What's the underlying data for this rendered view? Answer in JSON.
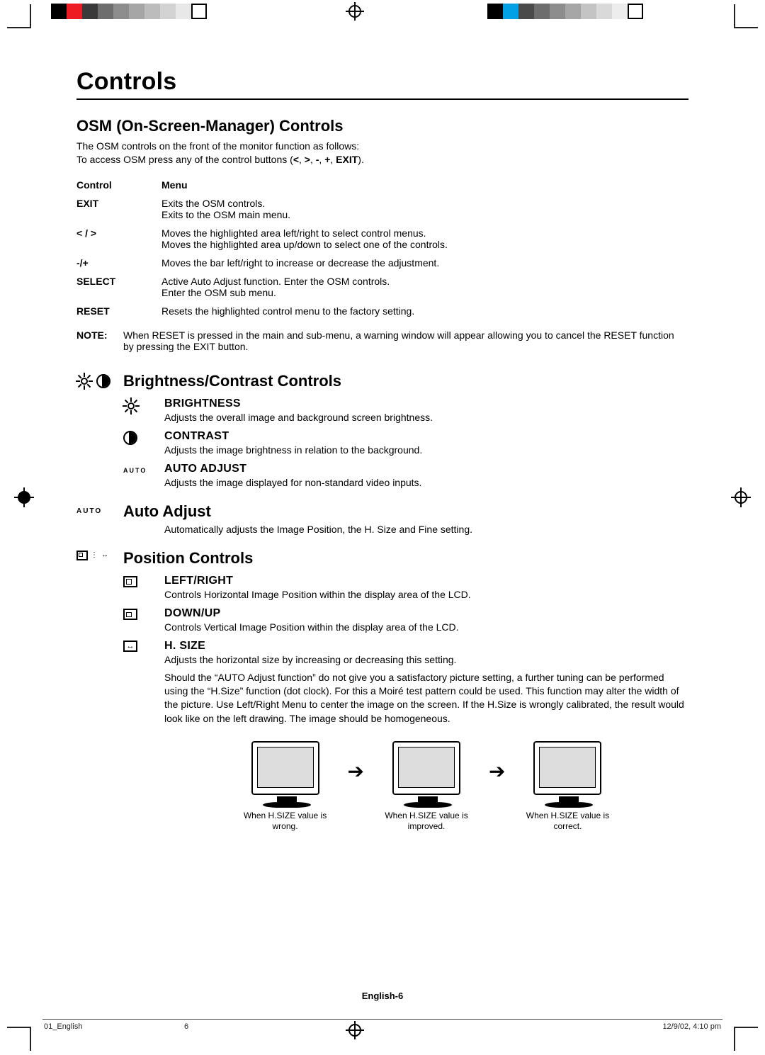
{
  "heading": "Controls",
  "osm": {
    "title": "OSM (On-Screen-Manager) Controls",
    "intro_line1": "The OSM controls on the front of the monitor function as follows:",
    "intro_line2_prefix": "To access OSM press any of the control buttons (",
    "intro_buttons": [
      "<",
      ">",
      "-",
      "+",
      "EXIT"
    ],
    "intro_line2_suffix": ").",
    "col_control": "Control",
    "col_menu": "Menu",
    "rows": [
      {
        "control": "EXIT",
        "menu": [
          "Exits the OSM controls.",
          "Exits to the OSM main menu."
        ]
      },
      {
        "control": "< / >",
        "menu": [
          "Moves the highlighted area left/right to select control menus.",
          "Moves the highlighted area up/down to select one of the controls."
        ]
      },
      {
        "control": "-/+",
        "menu": [
          "Moves the bar left/right to increase or decrease the adjustment."
        ]
      },
      {
        "control": "SELECT",
        "menu": [
          "Active Auto Adjust function. Enter the OSM controls.",
          "Enter the OSM sub menu."
        ]
      },
      {
        "control": "RESET",
        "menu": [
          "Resets the highlighted control menu to the factory setting."
        ]
      }
    ],
    "note_label": "NOTE:",
    "note_text": "When RESET is pressed in the main and sub-menu, a warning window will appear allowing you to cancel the RESET function by pressing the EXIT button."
  },
  "brightness_contrast": {
    "title": "Brightness/Contrast Controls",
    "items": [
      {
        "name": "BRIGHTNESS",
        "desc": "Adjusts the overall image and background screen brightness."
      },
      {
        "name": "CONTRAST",
        "desc": "Adjusts the image brightness in relation to the background."
      },
      {
        "name": "AUTO ADJUST",
        "desc": "Adjusts the image displayed for non-standard video inputs."
      }
    ]
  },
  "auto_section": {
    "tag": "AUTO",
    "title": "Auto Adjust",
    "desc": "Automatically adjusts the Image Position, the H. Size and Fine setting."
  },
  "position": {
    "title": "Position Controls",
    "items": [
      {
        "name": "LEFT/RIGHT",
        "desc": "Controls Horizontal Image Position within the display area of the LCD."
      },
      {
        "name": "DOWN/UP",
        "desc": "Controls Vertical Image Position within the display area of the LCD."
      },
      {
        "name": "H. SIZE",
        "desc": "Adjusts the horizontal size by increasing or decreasing this setting.",
        "desc2": "Should the “AUTO Adjust function” do not give you a satisfactory picture setting, a further tuning can be performed using the “H.Size” function (dot clock). For this a Moiré test pattern could be used. This function may alter the width of the picture. Use Left/Right Menu to center the image on the screen. If the H.Size is wrongly calibrated, the result would look like on the left drawing. The image should be homogeneous."
      }
    ]
  },
  "hsize_captions": [
    "When H.SIZE value is wrong.",
    "When H.SIZE value is improved.",
    "When H.SIZE value is correct."
  ],
  "footer": {
    "page": "English-6",
    "meta_left": "01_English",
    "meta_center": "6",
    "meta_right": "12/9/02, 4:10 pm"
  }
}
